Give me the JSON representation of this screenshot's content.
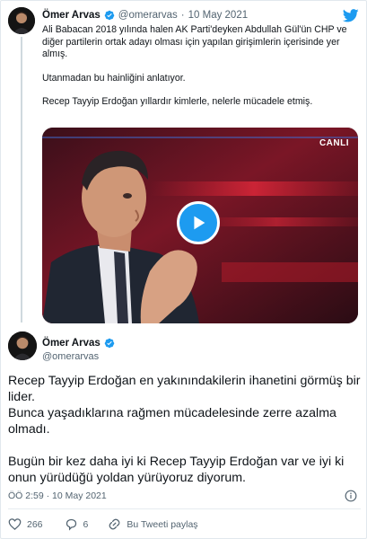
{
  "quoted_tweet": {
    "author_name": "Ömer Arvas",
    "handle": "@omerarvas",
    "separator": "·",
    "date": "10 May 2021",
    "paragraphs": [
      "Ali Babacan 2018 yılında halen AK Parti'deyken Abdullah Gül'ün CHP ve diğer partilerin ortak adayı olması için yapılan girişimlerin içerisinde yer almış.",
      "Utanmadan bu hainliğini anlatıyor.",
      "Recep Tayyip Erdoğan yıllardır kimlerle, nelerle mücadele etmiş."
    ],
    "video": {
      "live_badge": "CANLI",
      "play_icon": "play-icon"
    }
  },
  "main_tweet": {
    "author_name": "Ömer Arvas",
    "handle": "@omerarvas",
    "lines": [
      "Recep Tayyip Erdoğan en yakınındakilerin ihanetini görmüş bir lider.",
      "Bunca yaşadıklarına rağmen mücadelesinde zerre azalma olmadı.",
      "Bugün bir kez daha iyi ki Recep Tayyip Erdoğan var ve iyi ki onun yürüdüğü yoldan yürüyoruz diyorum."
    ],
    "timestamp": "ÖÖ 2:59 · 10 May 2021",
    "actions": {
      "likes": "266",
      "replies": "6",
      "share_label": "Bu Tweeti paylaş"
    }
  },
  "icons": {
    "brand": "twitter-bird-icon",
    "verified": "verified-badge-icon",
    "info": "info-icon",
    "like": "heart-icon",
    "reply": "reply-bubble-icon",
    "share": "share-icon"
  },
  "colors": {
    "brand_blue": "#1d9bf0",
    "text": "#0f1419",
    "muted": "#536471",
    "border": "#e1e8ed"
  }
}
